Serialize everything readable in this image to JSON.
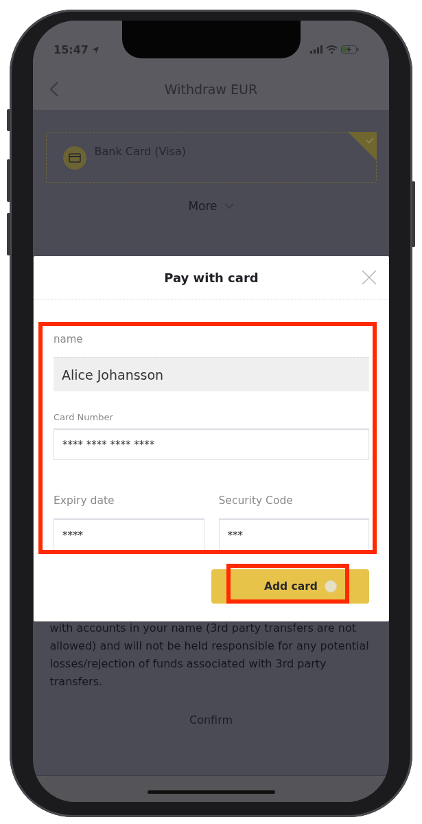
{
  "status_bar": {
    "time": "15:47"
  },
  "nav": {
    "title": "Withdraw EUR"
  },
  "payment_methods": [
    {
      "label": "Bank Card (Visa)",
      "selected": true
    }
  ],
  "more": {
    "label": "More"
  },
  "notice": "with accounts in your name (3rd party transfers are not allowed) and will not be held responsible for any potential losses/rejection of funds associated with 3rd party transfers.",
  "confirm_button": {
    "label": "Confirm"
  },
  "dialog": {
    "title": "Pay with card",
    "field_rows": [
      [
        {
          "label": "name",
          "value": "Alice Johansson",
          "kind": "filled"
        }
      ],
      [
        {
          "label": "Card Number",
          "value": "**** **** **** ****",
          "kind": "outlined"
        }
      ],
      [
        {
          "label": "Expiry date",
          "value": "****",
          "kind": "outlined"
        },
        {
          "label": "Security Code",
          "value": "***",
          "kind": "outlined"
        }
      ]
    ],
    "button": {
      "label": "Add card",
      "loading": true
    },
    "highlight": {
      "form": true,
      "button": true
    }
  }
}
